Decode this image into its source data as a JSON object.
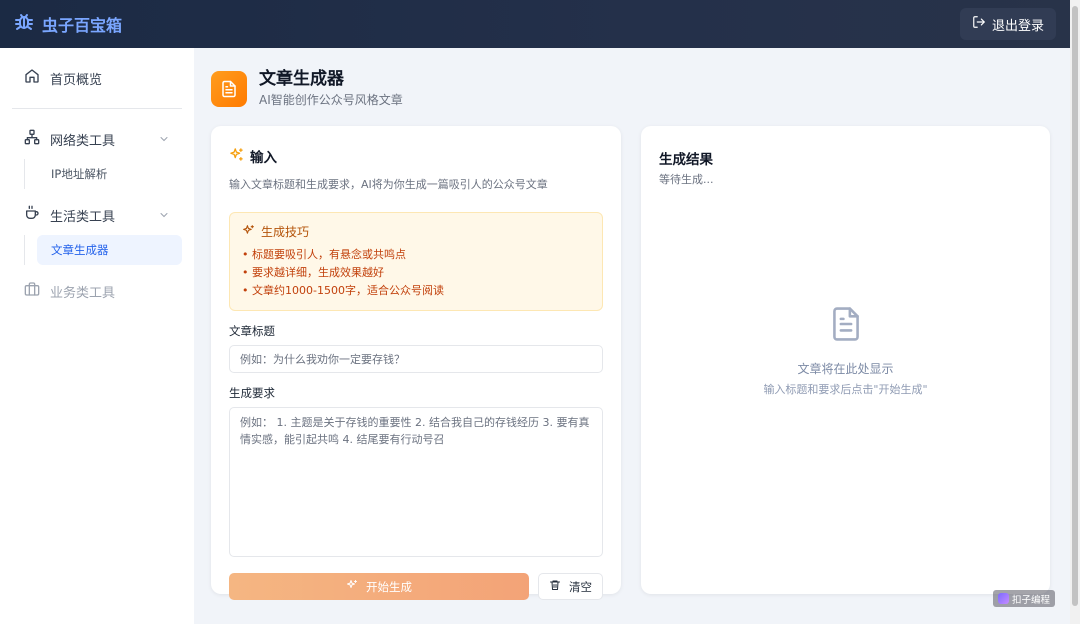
{
  "header": {
    "brand": "虫子百宝箱",
    "logout_label": "退出登录"
  },
  "sidebar": {
    "home": "首页概览",
    "network": {
      "label": "网络类工具",
      "items": [
        "IP地址解析"
      ]
    },
    "life": {
      "label": "生活类工具",
      "items": [
        "文章生成器"
      ]
    },
    "business": "业务类工具"
  },
  "page": {
    "title": "文章生成器",
    "subtitle": "AI智能创作公众号风格文章"
  },
  "input_card": {
    "title": "输入",
    "desc": "输入文章标题和生成要求，AI将为你生成一篇吸引人的公众号文章",
    "tips_title": "生成技巧",
    "tips": [
      "• 标题要吸引人，有悬念或共鸣点",
      "• 要求越详细，生成效果越好",
      "• 文章约1000-1500字，适合公众号阅读"
    ],
    "title_label": "文章标题",
    "title_placeholder": "例如：为什么我劝你一定要存钱？",
    "req_label": "生成要求",
    "req_placeholder": "例如： 1. 主题是关于存钱的重要性 2. 结合我自己的存钱经历 3. 要有真情实感，能引起共鸣 4. 结尾要有行动号召",
    "generate_label": "开始生成",
    "clear_label": "清空"
  },
  "result_card": {
    "title": "生成结果",
    "status": "等待生成...",
    "empty_main": "文章将在此处显示",
    "empty_sub": "输入标题和要求后点击\"开始生成\""
  },
  "watermark": "扣子编程",
  "colors": {
    "header_bg": "#1b2a44",
    "brand": "#7aa6ff",
    "accent_orange": "#ff8a00",
    "active_blue": "#2563eb",
    "tips_bg": "#fff8e8"
  }
}
